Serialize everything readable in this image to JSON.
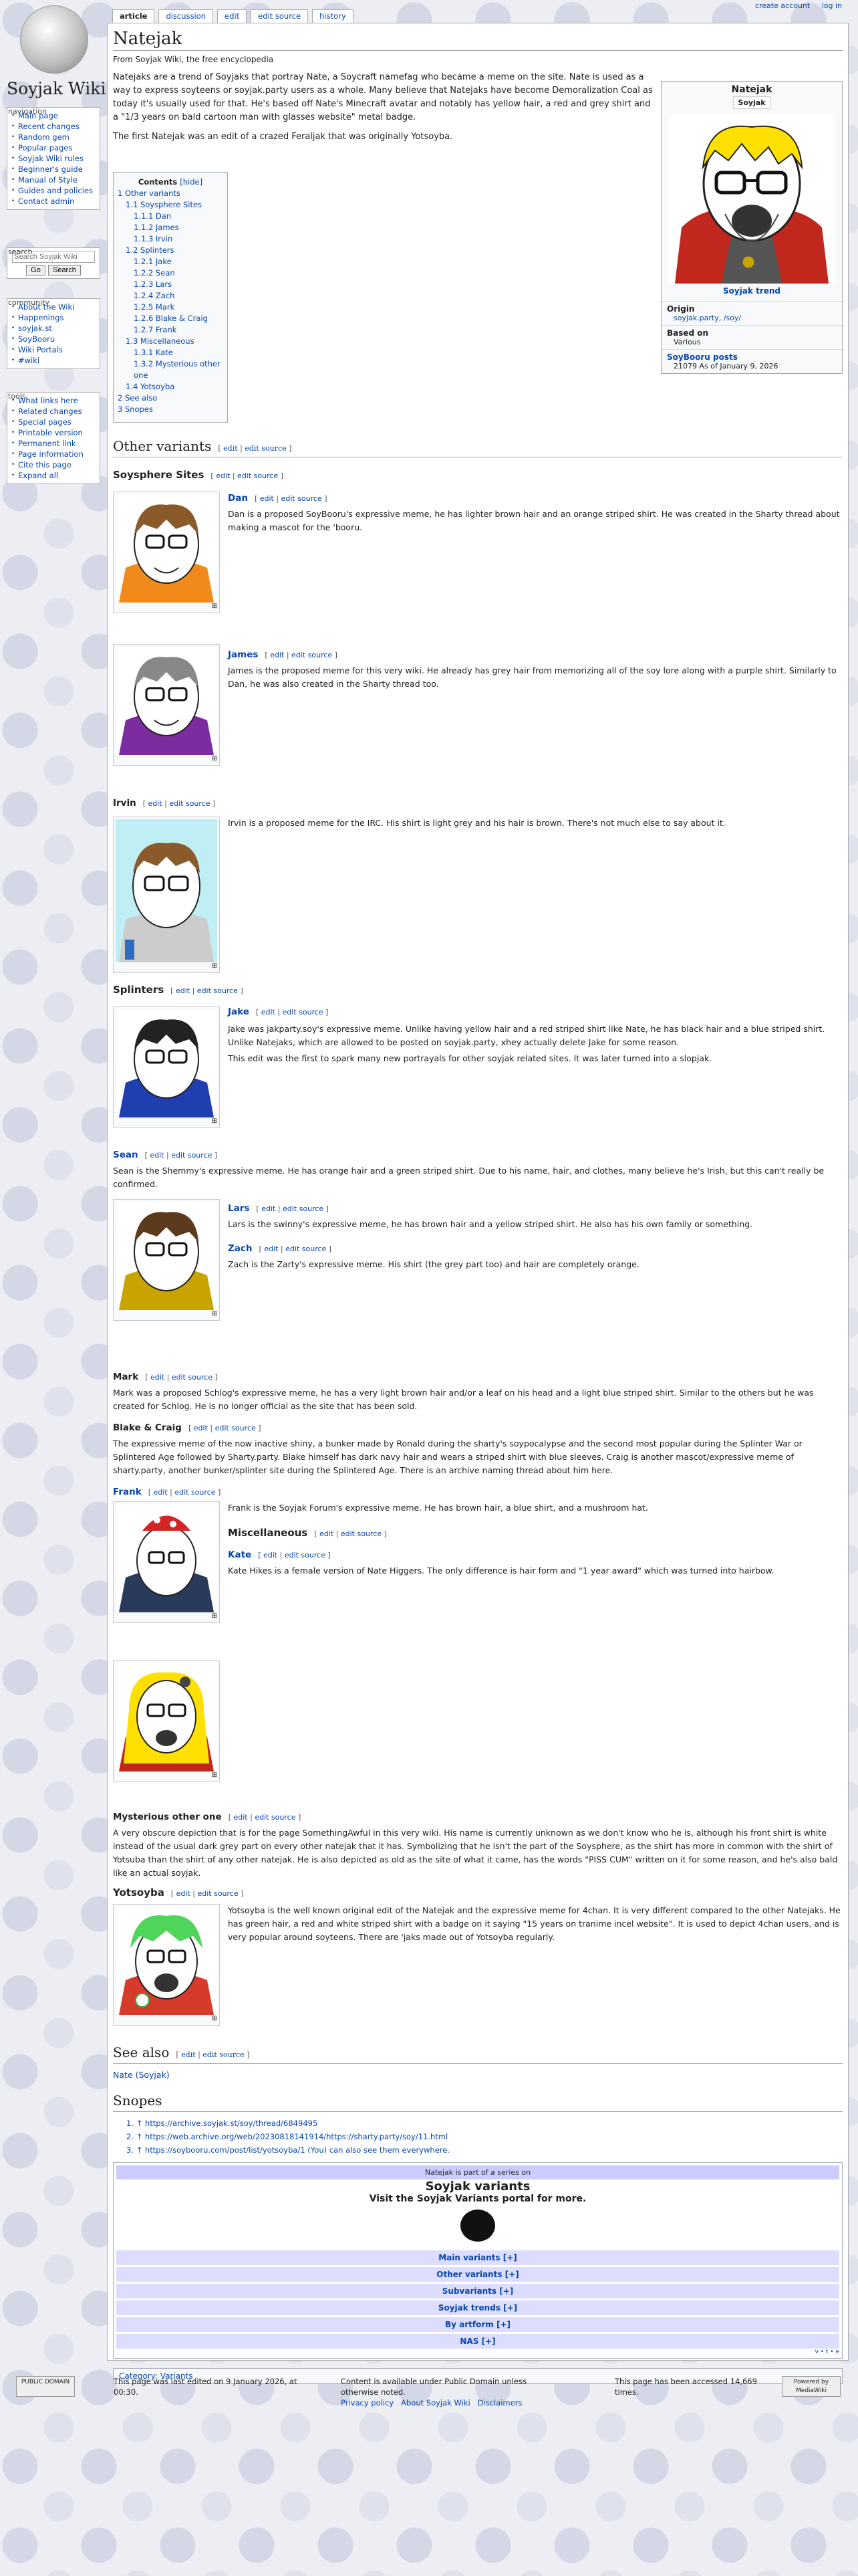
{
  "site": {
    "wordmark": "Soyjak Wiki"
  },
  "personal": {
    "create": "create account",
    "login": "log in"
  },
  "tabs": [
    "article",
    "discussion",
    "edit",
    "edit source",
    "history"
  ],
  "nav": {
    "navigation_title": "navigation",
    "navigation": [
      "Main page",
      "Recent changes",
      "Random gem",
      "Popular pages",
      "Soyjak Wiki rules",
      "Beginner's guide",
      "Manual of Style",
      "Guides and policies",
      "Contact admin"
    ],
    "search_title": "search",
    "search_placeholder": "Search Soyjak Wiki",
    "go": "Go",
    "search": "Search",
    "community_title": "community",
    "community": [
      "About the Wiki",
      "Happenings",
      "soyjak.st",
      "SoyBooru",
      "Wiki Portals",
      "#wiki"
    ],
    "tools_title": "tools",
    "tools": [
      "What links here",
      "Related changes",
      "Special pages",
      "Printable version",
      "Permanent link",
      "Page information",
      "Cite this page",
      "Expand all"
    ]
  },
  "page": {
    "title": "Natejak",
    "sub": "From Soyjak Wiki, the free encyclopedia",
    "intro1": "Natejaks are a trend of Soyjaks that portray Nate, a Soycraft namefag who became a meme on the site. Nate is used as a way to express soyteens or soyjak.party users as a whole. Many believe that Natejaks have become Demoralization Coal as today it's usually used for that. He's based off Nate's Minecraft avatar and notably has yellow hair, a red and grey shirt and a \"1/3 years on bald cartoon man with glasses website\" metal badge.",
    "intro2": "The first Natejak was an edit of a crazed Feraljak that was originally Yotsoyba."
  },
  "infobox": {
    "title": "Natejak",
    "label": "Soyjak",
    "caption": "Soyjak trend",
    "origin_k": "Origin",
    "origin_v": "soyjak.party, /soy/",
    "based_k": "Based on",
    "based_v": "Various",
    "booru_k": "SoyBooru posts",
    "booru_v": "21079 As of January 9, 2026"
  },
  "toc": {
    "title": "Contents",
    "hide": "[hide]",
    "items": [
      "1 Other variants",
      "1.1 Soysphere Sites",
      "1.1.1 Dan",
      "1.1.2 James",
      "1.1.3 Irvin",
      "1.2 Splinters",
      "1.2.1 Jake",
      "1.2.2 Sean",
      "1.2.3 Lars",
      "1.2.4 Zach",
      "1.2.5 Mark",
      "1.2.6 Blake & Craig",
      "1.2.7 Frank",
      "1.3 Miscellaneous",
      "1.3.1 Kate",
      "1.3.2 Mysterious other one",
      "1.4 Yotsoyba",
      "2 See also",
      "3 Snopes"
    ]
  },
  "edit": {
    "edit": "edit",
    "source": "edit source"
  },
  "sections": {
    "other": "Other variants",
    "soysphere": "Soysphere Sites",
    "dan": "Dan",
    "dan_t": "Dan is a proposed SoyBooru's expressive meme, he has lighter brown hair and an orange striped shirt. He was created in the Sharty thread about making a mascot for the 'booru.",
    "james": "James",
    "james_t": "James is the proposed meme for this very wiki. He already has grey hair from memorizing all of the soy lore along with a purple shirt. Similarly to Dan, he was also created in the Sharty thread too.",
    "irvin": "Irvin",
    "irvin_t": "Irvin is a proposed meme for the IRC. His shirt is light grey and his hair is brown. There's not much else to say about it.",
    "splinters": "Splinters",
    "jake": "Jake",
    "jake_t": "Jake was jakparty.soy's expressive meme. Unlike having yellow hair and a red striped shirt like Nate, he has black hair and a blue striped shirt. Unlike Natejaks, which are allowed to be posted on soyjak.party, xhey actually delete Jake for some reason.",
    "jake_t2": "This edit was the first to spark many new portrayals for other soyjak related sites. It was later turned into a slopjak.",
    "sean": "Sean",
    "sean_t": "Sean is the Shemmy's expressive meme. He has orange hair and a green striped shirt. Due to his name, hair, and clothes, many believe he's Irish, but this can't really be confirmed.",
    "lars": "Lars",
    "lars_t": "Lars is the swinny's expressive meme, he has brown hair and a yellow striped shirt. He also has his own family or something.",
    "zach": "Zach",
    "zach_t": "Zach is the Zarty's expressive meme. His shirt (the grey part too) and hair are completely orange.",
    "mark": "Mark",
    "mark_t": "Mark was a proposed Schlog's expressive meme, he has a very light brown hair and/or a leaf on his head and a light blue striped shirt. Similar to the others but he was created for Schlog. He is no longer official as the site that has been sold.",
    "blake": "Blake & Craig",
    "blake_t": "The expressive meme of the now inactive shiny, a bunker made by Ronald during the sharty's soypocalypse and the second most popular during the Splinter War or Splintered Age followed by Sharty.party. Blake himself has dark navy hair and wears a striped shirt with blue sleeves. Craig is another mascot/expressive meme of sharty.party, another bunker/splinter site during the Splintered Age. There is an archive naming thread about him here.",
    "frank": "Frank",
    "frank_t": "Frank is the Soyjak Forum's expressive meme. He has brown hair, a blue shirt, and a mushroom hat.",
    "misc": "Miscellaneous",
    "kate": "Kate",
    "kate_t": "Kate Hikes is a female version of Nate Higgers. The only difference is hair form and \"1 year award\" which was turned into hairbow.",
    "myst": "Mysterious other one",
    "myst_t": "A very obscure depiction that is for the page SomethingAwful in this very wiki. His name is currently unknown as we don't know who he is, although his front shirt is white instead of the usual dark grey part on every other natejak that it has. Symbolizing that he isn't the part of the Soysphere, as the shirt has more in common with the shirt of Yotsuba than the shirt of any other natejak. He is also depicted as old as the site of what it came, has the words \"PISS CUM\" written on it for some reason, and he's also bald like an actual soyjak.",
    "yots": "Yotsoyba",
    "yots_t": "Yotsoyba is the well known original edit of the Natejak and the expressive meme for 4chan. It is very different compared to the other Natejaks. He has green hair, a red and white striped shirt with a badge on it saying \"15 years on tranime incel website\". It is used to depict 4chan users, and is very popular around soyteens. There are 'jaks made out of Yotsoyba regularly.",
    "see": "See also",
    "see_t": "Nate (Soyjak)",
    "snopes": "Snopes",
    "snopes_list": [
      "1. ↑ https://archive.soyjak.st/soy/thread/6849495",
      "2. ↑ https://web.archive.org/web/20230818141914/https://sharty.party/soy/11.html",
      "3. ↑ https://soybooru.com/post/list/yotsoyba/1 (You) can also see them everywhere."
    ]
  },
  "navbox": {
    "top": "Natejak is part of a series on",
    "t1": "Soyjak variants",
    "t2": "Visit the Soyjak Variants portal for more.",
    "groups": [
      "Main variants [+]",
      "Other variants [+]",
      "Subvariants [+]",
      "Soyjak trends [+]",
      "By artform [+]",
      "NAS [+]"
    ],
    "vte": "v • t • e"
  },
  "cat": "Category: Variants",
  "footer": {
    "c1": "This page was last edited on 9 January 2026, at 00:30.",
    "c2": "Content is available under Public Domain unless otherwise noted.",
    "c3": "This page has been accessed 14,669 times.",
    "privacy": "Privacy policy",
    "about": "About Soyjak Wiki",
    "disc": "Disclaimers",
    "pd": "PUBLIC DOMAIN",
    "mw": "Powered by MediaWiki"
  },
  "colors": {
    "link": "#0645ad",
    "nate_hair": "#ffe000",
    "nate_shirt": "#c0281e"
  }
}
